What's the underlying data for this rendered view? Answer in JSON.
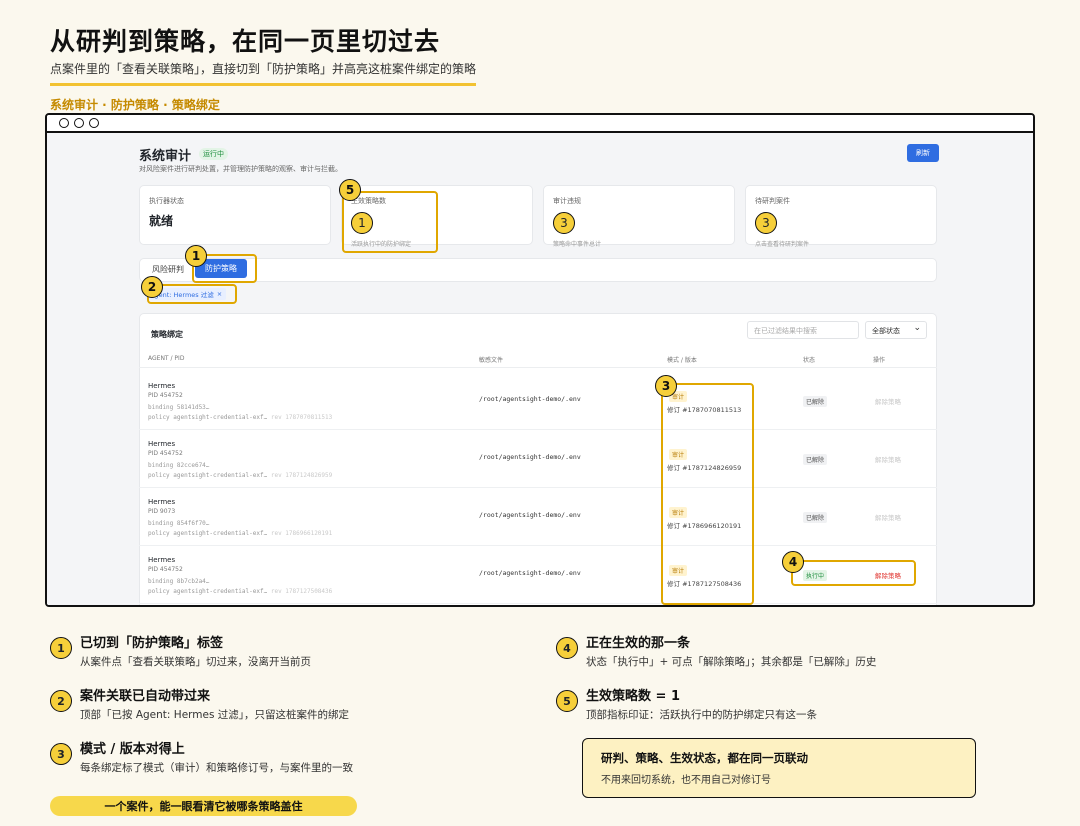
{
  "header": {
    "title": "从研判到策略，在同一页里切过去",
    "subtitle": "点案件里的「查看关联策略」，直接切到「防护策略」并高亮这桩案件绑定的策略",
    "section": "系统审计 · 防护策略 · 策略绑定"
  },
  "app": {
    "title": "系统审计",
    "badge": "运行中",
    "description": "对风险案件进行研判处置，并管理防护策略的观察、审计与拦截。",
    "refresh": "刷新",
    "cards": [
      {
        "label": "执行器状态",
        "value": "就绪",
        "note": ""
      },
      {
        "label": "生效策略数",
        "value": "1",
        "note": "活跃执行中的防护绑定"
      },
      {
        "label": "审计违规",
        "value": "3",
        "note": "策略命中事件总计"
      },
      {
        "label": "待研判案件",
        "value": "3",
        "note": "点击查看待研判案件"
      }
    ],
    "tabs": {
      "risk": "风险研判",
      "policy": "防护策略"
    },
    "filter_chip": {
      "label": "Agent: Hermes 过滤",
      "close": "×"
    },
    "panel": {
      "title": "策略绑定",
      "search_placeholder": "在已过滤结果中搜索",
      "status_filter": "全部状态",
      "columns": [
        "AGENT / PID",
        "敏感文件",
        "模式 / 版本",
        "状态",
        "操作"
      ]
    },
    "rows": [
      {
        "agent": "Hermes",
        "pid": "PID 454752",
        "binding": "binding 58141d53…",
        "policy": "policy agentsight-credential-exf…",
        "policy_rev": "rev 1787070811513",
        "file": "/root/agentsight-demo/.env",
        "mode": "审计",
        "revision": "修订 #1787070811513",
        "status": "已解除",
        "action": "解除策略",
        "live": false
      },
      {
        "agent": "Hermes",
        "pid": "PID 454752",
        "binding": "binding 82cce674…",
        "policy": "policy agentsight-credential-exf…",
        "policy_rev": "rev 1787124826959",
        "file": "/root/agentsight-demo/.env",
        "mode": "审计",
        "revision": "修订 #1787124826959",
        "status": "已解除",
        "action": "解除策略",
        "live": false
      },
      {
        "agent": "Hermes",
        "pid": "PID 9073",
        "binding": "binding 854f6f70…",
        "policy": "policy agentsight-credential-exf…",
        "policy_rev": "rev 1786966120191",
        "file": "/root/agentsight-demo/.env",
        "mode": "审计",
        "revision": "修订 #1786966120191",
        "status": "已解除",
        "action": "解除策略",
        "live": false
      },
      {
        "agent": "Hermes",
        "pid": "PID 454752",
        "binding": "binding 8b7cb2a4…",
        "policy": "policy agentsight-credential-exf…",
        "policy_rev": "rev 1787127508436",
        "file": "/root/agentsight-demo/.env",
        "mode": "审计",
        "revision": "修订 #1787127508436",
        "status": "执行中",
        "action": "解除策略",
        "live": true
      }
    ]
  },
  "markers": [
    "1",
    "2",
    "3",
    "4",
    "5"
  ],
  "legend": [
    {
      "num": "1",
      "title": "已切到「防护策略」标签",
      "desc": "从案件点「查看关联策略」切过来，没离开当前页"
    },
    {
      "num": "2",
      "title": "案件关联已自动带过来",
      "desc": "顶部「已按 Agent: Hermes 过滤」，只留这桩案件的绑定"
    },
    {
      "num": "3",
      "title": "模式 / 版本对得上",
      "desc": "每条绑定标了模式（审计）和策略修订号，与案件里的一致"
    },
    {
      "num": "4",
      "title": "正在生效的那一条",
      "desc": "状态「执行中」+ 可点「解除策略」；其余都是「已解除」历史"
    },
    {
      "num": "5",
      "title": "生效策略数 = 1",
      "desc": "顶部指标印证：活跃执行中的防护绑定只有这一条"
    }
  ],
  "callout": {
    "title": "研判、策略、生效状态，都在同一页联动",
    "desc": "不用来回切系统，也不用自己对修订号"
  },
  "pill": "一个案件，能一眼看清它被哪条策略盖住",
  "colors": {
    "accent": "#f2c231",
    "primary": "#2f6de1",
    "danger": "#e0342f",
    "success": "#1e8e3e"
  }
}
